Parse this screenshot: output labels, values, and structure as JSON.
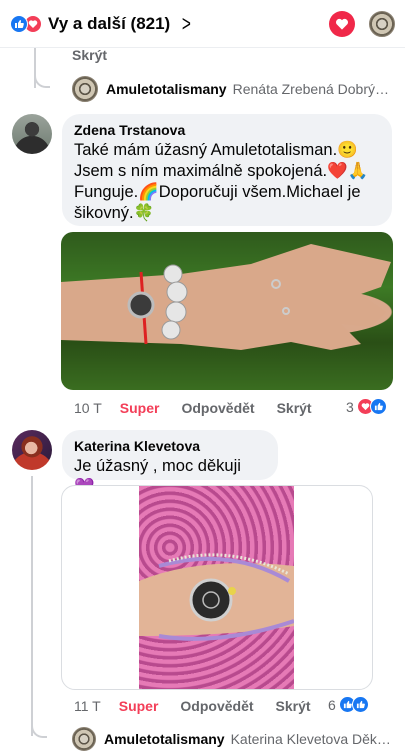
{
  "header": {
    "title": "Vy a další (821)"
  },
  "thread": {
    "hide_label": "Skrýt",
    "reply_preview_top": {
      "name": "Amuletotalismany",
      "text": "Renáta Zrebená Dobrý de..."
    },
    "reply_preview_bottom": {
      "name": "Amuletotalismany",
      "text": "Katerina Klevetova Děkuj..."
    }
  },
  "comments": [
    {
      "author": "Zdena Trstanova",
      "lines": [
        "Také mám úžasný Amuletotalisman.🙂",
        "Jsem s ním maximálně spokojená.❤️🙏",
        "Funguje.🌈Doporučuji všem.Michael je",
        "šikovný.🍀"
      ],
      "time": "10 T",
      "reaction_label": "Super",
      "reply_label": "Odpovědět",
      "hide_label": "Skrýt",
      "reaction_count": "3"
    },
    {
      "author": "Katerina Klevetova",
      "lines": [
        "Je úžasný , moc děkuji 💜"
      ],
      "time": "11 T",
      "reaction_label": "Super",
      "reply_label": "Odpovědět",
      "hide_label": "Skrýt",
      "reaction_count": "6"
    }
  ],
  "colors": {
    "like_blue": "#1877f2",
    "love_red": "#f33e58",
    "muted_text": "#65676b",
    "bubble_bg": "#f0f2f5"
  }
}
